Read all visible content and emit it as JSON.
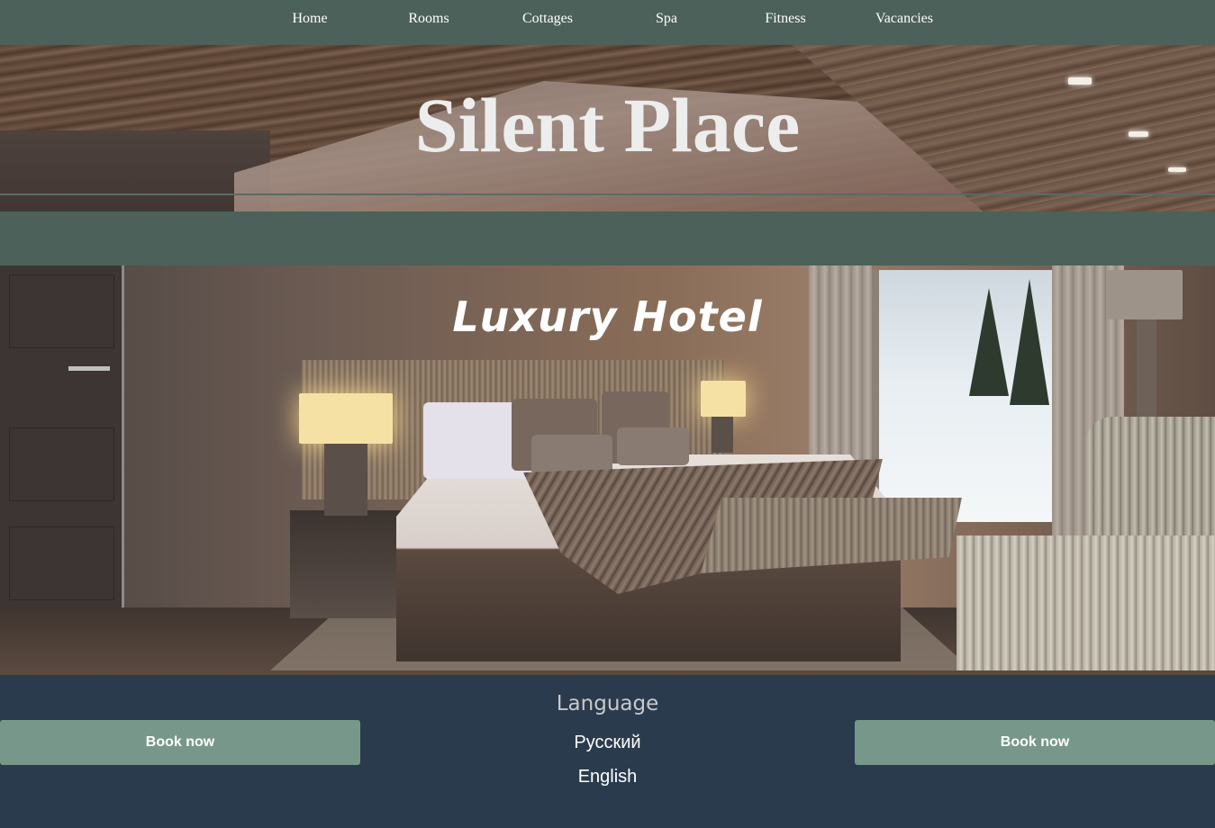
{
  "nav": {
    "items": [
      {
        "label": "Home"
      },
      {
        "label": "Rooms"
      },
      {
        "label": "Cottages"
      },
      {
        "label": "Spa"
      },
      {
        "label": "Fitness"
      },
      {
        "label": "Vacancies"
      }
    ]
  },
  "header": {
    "title": "Silent Place"
  },
  "hero": {
    "title": "Luxury Hotel"
  },
  "footer": {
    "book_left": "Book now",
    "book_right": "Book now",
    "language_title": "Language",
    "languages": [
      {
        "label": "Русский"
      },
      {
        "label": "English"
      }
    ]
  },
  "colors": {
    "nav_bg": "#4c6159",
    "footer_bg": "#2b3b4e",
    "button_bg": "#77978b"
  }
}
